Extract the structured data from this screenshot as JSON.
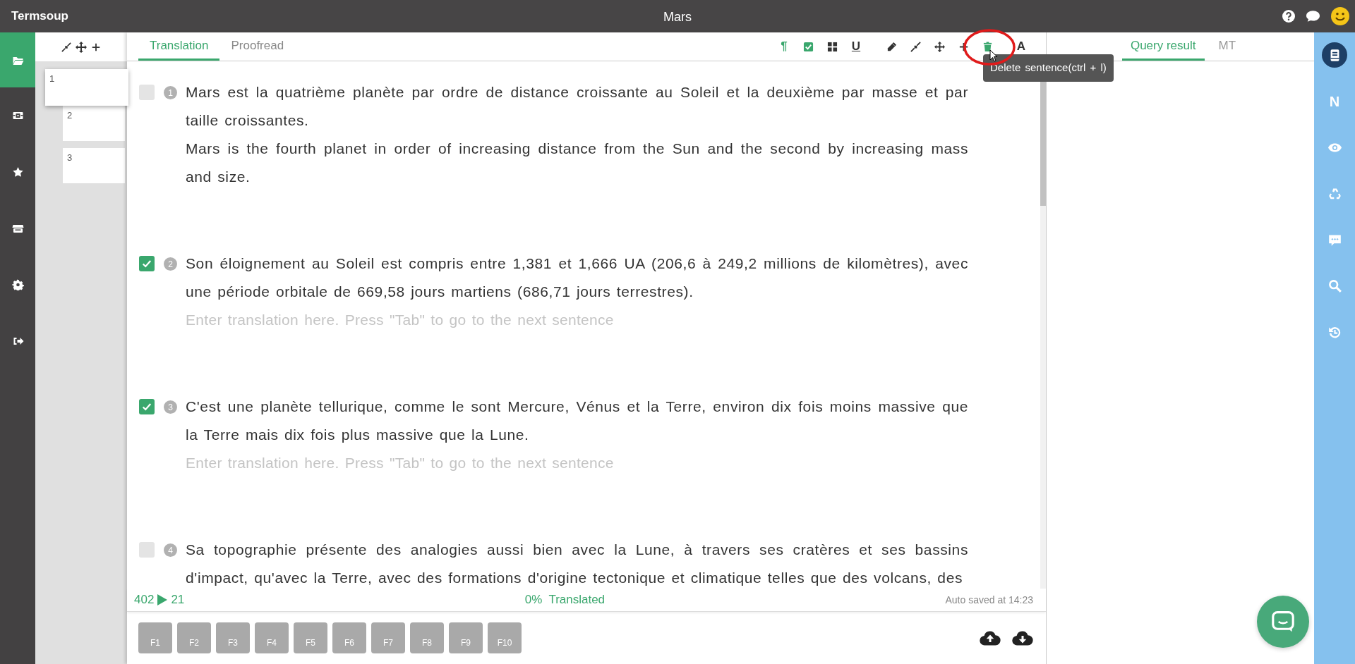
{
  "app": {
    "name": "Termsoup"
  },
  "document": {
    "title": "Mars"
  },
  "nav_items": [
    {
      "selected": true
    },
    {
      "selected": false
    },
    {
      "selected": false
    },
    {
      "selected": false
    },
    {
      "selected": false
    },
    {
      "selected": false
    }
  ],
  "thumbnails": [
    {
      "number": "1",
      "selected": true
    },
    {
      "number": "2",
      "selected": false
    },
    {
      "number": "3",
      "selected": false
    }
  ],
  "editor_tabs": [
    {
      "label": "Translation",
      "selected": true
    },
    {
      "label": "Proofread",
      "selected": false
    }
  ],
  "toolbar": [
    {
      "text": "¶",
      "active": true
    },
    {
      "active": true
    },
    {
      "active": false
    },
    {
      "text": "U",
      "active": false
    },
    {
      "active": false
    },
    {
      "active": false
    },
    {
      "active": false
    },
    {
      "active": false
    },
    {
      "active": true
    },
    {
      "text": "A",
      "active": false
    }
  ],
  "tooltip": "Delete sentence(ctrl + l)",
  "sentences": [
    {
      "number": "1",
      "checked": false,
      "source": "Mars est la quatrième planète par ordre de distance croissante au Soleil et la deuxième par masse et par taille croissantes.",
      "translation": "Mars is the fourth planet in order of increasing distance from the Sun and the second by increasing mass and size."
    },
    {
      "number": "2",
      "checked": true,
      "source": "Son éloignement au Soleil est compris entre 1,381 et 1,666 UA (206,6 à 249,2 millions de kilomètres), avec une période orbitale de 669,58 jours martiens (686,71 jours terrestres).",
      "placeholder": "Enter translation here. Press \"Tab\" to go to the next sentence"
    },
    {
      "number": "3",
      "checked": true,
      "source": "C'est une planète tellurique, comme le sont Mercure, Vénus et la Terre, environ dix fois moins massive que la Terre mais dix fois plus massive que la Lune.",
      "placeholder": "Enter translation here. Press \"Tab\" to go to the next sentence"
    },
    {
      "number": "4",
      "checked": false,
      "source": "Sa topographie présente des analogies aussi bien avec la Lune, à travers ses cratères et ses bassins d'impact, qu'avec la Terre, avec des formations d'origine tectonique et climatique telles que des volcans, des"
    }
  ],
  "stats": {
    "source_count": "402",
    "target_count": "21",
    "progress": "0%  Translated",
    "autosave": "Auto saved at 14:23"
  },
  "function_keys": [
    "F1",
    "F2",
    "F3",
    "F4",
    "F5",
    "F6",
    "F7",
    "F8",
    "F9",
    "F10"
  ],
  "side_tabs": [
    {
      "label": "Query result",
      "selected": true
    },
    {
      "label": "MT",
      "selected": false
    }
  ],
  "right_bar": [
    {
      "selected": true
    },
    {
      "text": "N",
      "selected": false
    },
    {
      "selected": false
    },
    {
      "selected": false
    },
    {
      "selected": false
    },
    {
      "selected": false
    },
    {
      "selected": false
    }
  ]
}
